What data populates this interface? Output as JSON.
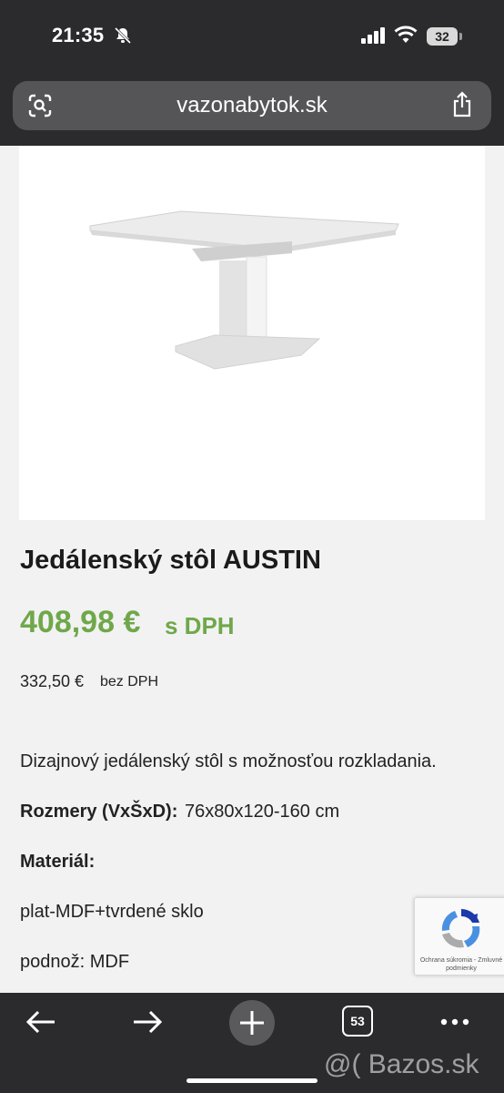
{
  "status_bar": {
    "time": "21:35",
    "battery": "32",
    "icons": [
      "bell-slash-icon",
      "signal-icon",
      "wifi-icon",
      "battery-icon"
    ]
  },
  "address_bar": {
    "url": "vazonabytok.sk",
    "icons": [
      "lens-icon",
      "share-icon"
    ]
  },
  "product": {
    "image_alt_icon": "dining-table-image",
    "title": "Jedálenský stôl AUSTIN",
    "price_with_vat": "408,98 €",
    "vat_label": "s DPH",
    "price_without_vat": "332,50 €",
    "no_vat_label": "bez DPH",
    "description": "Dizajnový jedálenský stôl s možnosťou rozkladania.",
    "dimensions_label": "Rozmery (VxŠxD):",
    "dimensions_value": "76x80x120-160 cm",
    "material_label": "Materiál:",
    "material_top": "plat-MDF+tvrdené sklo",
    "material_base": "podnož: MDF"
  },
  "recaptcha": {
    "text": "Ochrana súkromia - Zmluvné podmienky"
  },
  "toolbar": {
    "tab_count": "53",
    "icons": [
      "back-arrow-icon",
      "forward-arrow-icon",
      "plus-icon",
      "tabs-icon",
      "more-icon"
    ]
  },
  "watermark": "@( Bazos.sk",
  "colors": {
    "chrome": "#2b2b2d",
    "price_green": "#6fa84a",
    "page_bg": "#f2f2f2"
  }
}
